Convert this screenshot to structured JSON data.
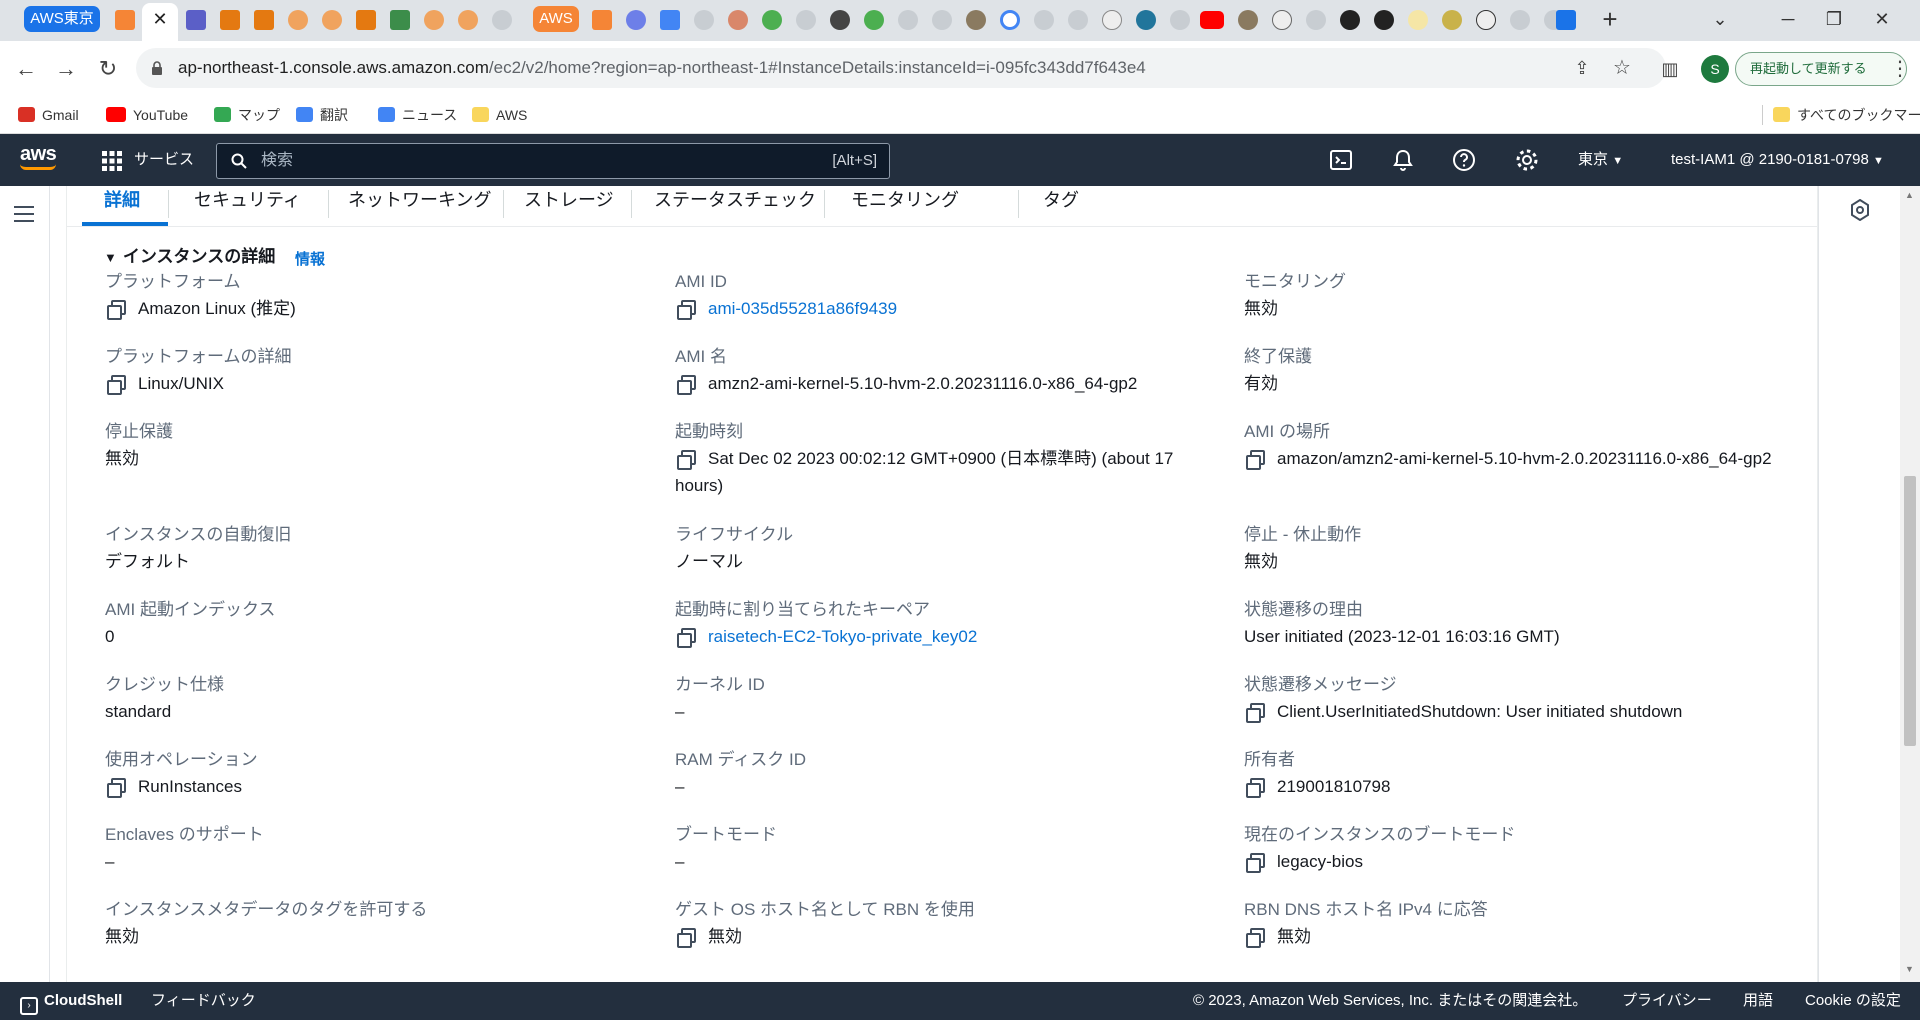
{
  "browser": {
    "tab_group_label": "AWS東京",
    "tab_group2_label": "AWS",
    "url_host": "ap-northeast-1.console.aws.amazon.com",
    "url_path": "/ec2/v2/home?region=ap-northeast-1#InstanceDetails:instanceId=i-095fc343dd7f643e4",
    "profile_initial": "S",
    "restart_label": "再起動して更新する"
  },
  "bookmarks": [
    {
      "label": "Gmail",
      "color": "#d93025"
    },
    {
      "label": "YouTube",
      "color": "#ff0000"
    },
    {
      "label": "マップ",
      "color": "#34a853"
    },
    {
      "label": "翻訳",
      "color": "#4285f4"
    },
    {
      "label": "ニュース",
      "color": "#4285f4"
    },
    {
      "label": "AWS",
      "color": "#f9d65c"
    }
  ],
  "bookmarks_all": "すべてのブックマーク",
  "aws_header": {
    "services_label": "サービス",
    "search_placeholder": "検索",
    "search_shortcut": "[Alt+S]",
    "region": "東京",
    "account": "test-IAM1 @ 2190-0181-0798"
  },
  "tabs": [
    "詳細",
    "セキュリティ",
    "ネットワーキング",
    "ストレージ",
    "ステータスチェック",
    "モニタリング",
    "タグ"
  ],
  "section": {
    "title": "インスタンスの詳細",
    "info": "情報"
  },
  "details": {
    "col1": [
      {
        "label": "プラットフォーム",
        "value": "Amazon Linux (推定)",
        "copy": true
      },
      {
        "label": "プラットフォームの詳細",
        "value": "Linux/UNIX",
        "copy": true
      },
      {
        "label": "停止保護",
        "value": "無効",
        "copy": false
      },
      {
        "label": "インスタンスの自動復旧",
        "value": "デフォルト",
        "copy": false
      },
      {
        "label": "AMI 起動インデックス",
        "value": "0",
        "copy": false
      },
      {
        "label": "クレジット仕様",
        "value": "standard",
        "copy": false
      },
      {
        "label": "使用オペレーション",
        "value": "RunInstances",
        "copy": true
      },
      {
        "label": "Enclaves のサポート",
        "value": "–",
        "copy": false
      },
      {
        "label": "インスタンスメタデータのタグを許可する",
        "value": "無効",
        "copy": false
      }
    ],
    "col2": [
      {
        "label": "AMI ID",
        "value": "ami-035d55281a86f9439",
        "copy": true,
        "link": true
      },
      {
        "label": "AMI 名",
        "value": "amzn2-ami-kernel-5.10-hvm-2.0.20231116.0-x86_64-gp2",
        "copy": true
      },
      {
        "label": "起動時刻",
        "value": "Sat Dec 02 2023 00:02:12 GMT+0900 (日本標準時) (about 17 hours)",
        "copy": true
      },
      {
        "label": "ライフサイクル",
        "value": "ノーマル",
        "copy": false
      },
      {
        "label": "起動時に割り当てられたキーペア",
        "value": "raisetech-EC2-Tokyo-private_key02",
        "copy": true,
        "link": true
      },
      {
        "label": "カーネル ID",
        "value": "–",
        "copy": false
      },
      {
        "label": "RAM ディスク ID",
        "value": "–",
        "copy": false
      },
      {
        "label": "ブートモード",
        "value": "–",
        "copy": false
      },
      {
        "label": "ゲスト OS ホスト名として RBN を使用",
        "value": "無効",
        "copy": true
      }
    ],
    "col3": [
      {
        "label": "モニタリング",
        "value": "無効",
        "copy": false
      },
      {
        "label": "終了保護",
        "value": "有効",
        "copy": false
      },
      {
        "label": "AMI の場所",
        "value": "amazon/amzn2-ami-kernel-5.10-hvm-2.0.20231116.0-x86_64-gp2",
        "copy": true
      },
      {
        "label": "停止 - 休止動作",
        "value": "無効",
        "copy": false
      },
      {
        "label": "状態遷移の理由",
        "value": "User initiated (2023-12-01 16:03:16 GMT)",
        "copy": false
      },
      {
        "label": "状態遷移メッセージ",
        "value": "Client.UserInitiatedShutdown: User initiated shutdown",
        "copy": true
      },
      {
        "label": "所有者",
        "value": "219001810798",
        "copy": true
      },
      {
        "label": "現在のインスタンスのブートモード",
        "value": "legacy-bios",
        "copy": true
      },
      {
        "label": "RBN DNS ホスト名 IPv4 に応答",
        "value": "無効",
        "copy": true
      }
    ]
  },
  "footer": {
    "cloudshell": "CloudShell",
    "feedback": "フィードバック",
    "copyright": "© 2023, Amazon Web Services, Inc. またはその関連会社。",
    "privacy": "プライバシー",
    "terms": "用語",
    "cookie": "Cookie の設定"
  },
  "colors": {
    "aws_dark": "#232f3e",
    "link_blue": "#0972d3",
    "aws_orange": "#ff9900"
  }
}
